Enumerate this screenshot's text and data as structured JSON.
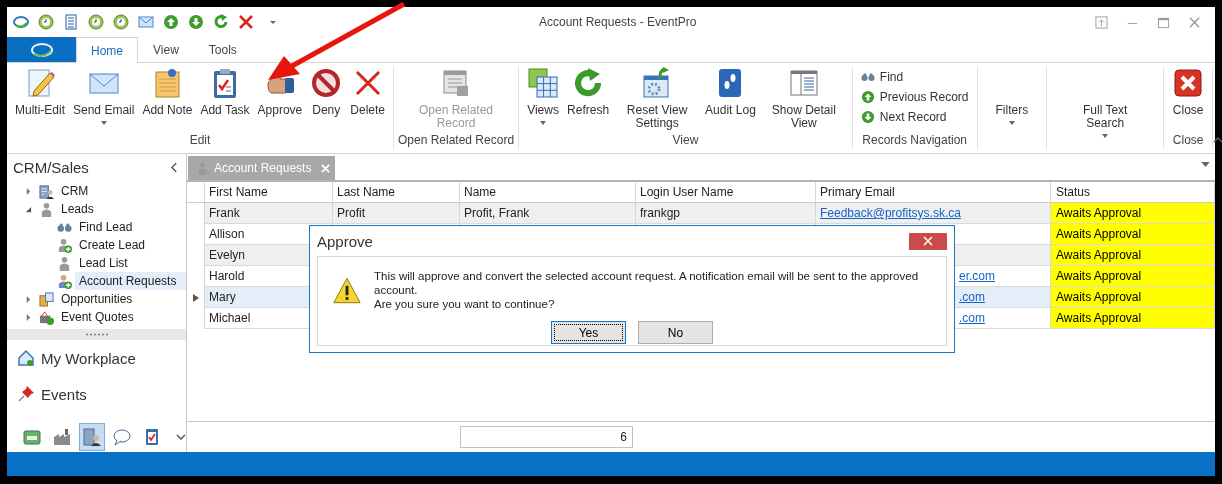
{
  "window": {
    "title": "Account Requests - EventPro"
  },
  "ribbon_tabs": [
    {
      "label": "Home",
      "selected": true
    },
    {
      "label": "View",
      "selected": false
    },
    {
      "label": "Tools",
      "selected": false
    }
  ],
  "ribbon_groups": [
    {
      "label": "Edit",
      "kind": "large",
      "buttons": [
        {
          "label": "Multi-Edit",
          "dropdown": false,
          "disabled": false
        },
        {
          "label": "Send Email",
          "dropdown": true,
          "disabled": false
        },
        {
          "label": "Add Note",
          "dropdown": false,
          "disabled": false
        },
        {
          "label": "Add Task",
          "dropdown": false,
          "disabled": false
        },
        {
          "label": "Approve",
          "dropdown": false,
          "disabled": false
        },
        {
          "label": "Deny",
          "dropdown": false,
          "disabled": false
        },
        {
          "label": "Delete",
          "dropdown": false,
          "disabled": false
        }
      ]
    },
    {
      "label": "Open Related Record",
      "kind": "large",
      "buttons": [
        {
          "label": "Open Related Record",
          "dropdown": false,
          "disabled": true
        }
      ]
    },
    {
      "label": "View",
      "kind": "large",
      "buttons": [
        {
          "label": "Views",
          "dropdown": true,
          "disabled": false
        },
        {
          "label": "Refresh",
          "dropdown": false,
          "disabled": false
        },
        {
          "label": "Reset View Settings",
          "dropdown": false,
          "disabled": false
        },
        {
          "label": "Audit Log",
          "dropdown": false,
          "disabled": false
        },
        {
          "label": "Show Detail View",
          "dropdown": false,
          "disabled": false
        }
      ]
    },
    {
      "label": "Records Navigation",
      "kind": "small",
      "buttons": [
        {
          "label": "Find"
        },
        {
          "label": "Previous Record"
        },
        {
          "label": "Next Record"
        }
      ]
    },
    {
      "kind": "large",
      "buttons": [
        {
          "label": "Filters",
          "dropdown": true,
          "disabled": false
        }
      ]
    },
    {
      "kind": "large",
      "buttons": [
        {
          "label": "Full Text Search",
          "dropdown": true,
          "disabled": false
        }
      ]
    },
    {
      "label": "Close",
      "kind": "large",
      "buttons": [
        {
          "label": "Close",
          "dropdown": false,
          "disabled": false
        }
      ]
    }
  ],
  "sidebar": {
    "title": "CRM/Sales",
    "tree": [
      {
        "label": "CRM",
        "expanded": false,
        "selected": false
      },
      {
        "label": "Leads",
        "expanded": true,
        "selected": false,
        "children": [
          {
            "label": "Find Lead",
            "selected": false
          },
          {
            "label": "Create Lead",
            "selected": false
          },
          {
            "label": "Lead List",
            "selected": false
          },
          {
            "label": "Account Requests",
            "selected": true
          }
        ]
      },
      {
        "label": "Opportunities",
        "expanded": false,
        "selected": false
      },
      {
        "label": "Event Quotes",
        "expanded": false,
        "selected": false
      }
    ],
    "panes": [
      {
        "label": "My Workplace"
      },
      {
        "label": "Events"
      }
    ],
    "bottom_icons": [
      {
        "selected": false
      },
      {
        "selected": false
      },
      {
        "selected": true
      },
      {
        "selected": false
      },
      {
        "selected": false
      }
    ]
  },
  "document_tab": {
    "label": "Account Requests"
  },
  "table": {
    "columns": [
      "First Name",
      "Last Name",
      "Name",
      "Login User Name",
      "Primary Email",
      "Status"
    ],
    "rows": [
      {
        "selected": false,
        "first_name": "Frank",
        "last_name": "Profit",
        "name": "Profit, Frank",
        "login": "frankgp",
        "email": "Feedback@profitsys.sk.ca",
        "status": "Awaits Approval"
      },
      {
        "selected": false,
        "first_name": "Allison",
        "status": "Awaits Approval"
      },
      {
        "selected": false,
        "first_name": "Evelyn",
        "status": "Awaits Approval"
      },
      {
        "selected": false,
        "first_name": "Harold",
        "email": "er.com",
        "status": "Awaits Approval"
      },
      {
        "selected": true,
        "first_name": "Mary",
        "email": ".com",
        "status": "Awaits Approval"
      },
      {
        "selected": false,
        "first_name": "Michael",
        "email": ".com",
        "status": "Awaits Approval"
      }
    ],
    "footer_count": "6"
  },
  "dialog": {
    "title": "Approve",
    "message_lines": [
      "This will approve and convert the selected account request. A notification email will be sent to the approved account.",
      "Are you sure you want to continue?"
    ],
    "buttons": [
      {
        "label": "Yes",
        "default": true
      },
      {
        "label": "No",
        "default": false
      }
    ]
  }
}
